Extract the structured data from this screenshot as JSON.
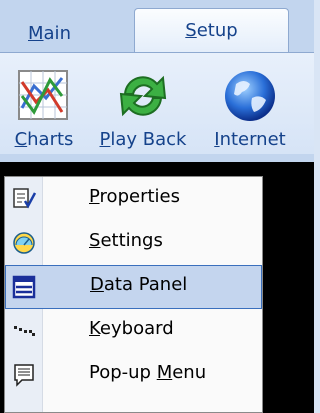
{
  "tabs": [
    {
      "prefix": "",
      "hotkey": "M",
      "rest": "ain"
    },
    {
      "prefix": "",
      "hotkey": "S",
      "rest": "etup"
    }
  ],
  "ribbon": {
    "buttons": [
      {
        "prefix": "",
        "hotkey": "C",
        "rest": "harts",
        "icon": "chart-icon"
      },
      {
        "prefix": "",
        "hotkey": "P",
        "rest": "lay Back",
        "icon": "refresh-icon"
      },
      {
        "prefix": "",
        "hotkey": "I",
        "rest": "nternet",
        "icon": "globe-icon"
      }
    ]
  },
  "menu": {
    "items": [
      {
        "prefix": "",
        "hotkey": "P",
        "rest": "roperties",
        "icon": "properties-icon",
        "selected": false
      },
      {
        "prefix": "",
        "hotkey": "S",
        "rest": "ettings",
        "icon": "settings-icon",
        "selected": false
      },
      {
        "prefix": "",
        "hotkey": "D",
        "rest": "ata Panel",
        "icon": "data-panel-icon",
        "selected": true
      },
      {
        "prefix": "",
        "hotkey": "K",
        "rest": "eyboard",
        "icon": "keyboard-icon",
        "selected": false
      },
      {
        "prefix": "Pop-up ",
        "hotkey": "M",
        "rest": "enu",
        "icon": "popup-menu-icon",
        "selected": false
      }
    ]
  }
}
